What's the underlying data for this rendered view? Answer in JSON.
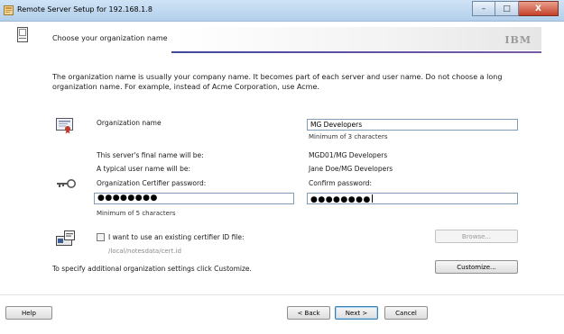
{
  "window": {
    "title": "Remote Server Setup for 192.168.1.8",
    "minimize_glyph": "–",
    "maximize_glyph": "□",
    "close_glyph": "X"
  },
  "header": {
    "heading": "Choose your organization name",
    "logo_text": "IBM"
  },
  "description": "The organization name is usually your company name. It becomes part of each server and user name. Do not choose a long organization name. For example, instead of Acme Corporation, use Acme.",
  "org": {
    "label": "Organization name",
    "value": "MG Developers",
    "hint": "Minimum of 3 characters"
  },
  "names": {
    "server_label": "This server's final name will be:",
    "server_value": "MGD01/MG Developers",
    "user_label": "A typical user name will be:",
    "user_value": "Jane Doe/MG Developers"
  },
  "password": {
    "label": "Organization Certifier password:",
    "value": "●●●●●●●●",
    "hint": "Minimum of 5 characters",
    "confirm_label": "Confirm password:",
    "confirm_value": "●●●●●●●●"
  },
  "certifier": {
    "checkbox_label": "I want to use an existing certifier ID file:",
    "checked": false,
    "path": "/local/notesdata/cert.id",
    "browse_label": "Browse..."
  },
  "customize": {
    "text": "To specify additional organization settings click Customize.",
    "button_label": "Customize..."
  },
  "footer": {
    "help_label": "Help",
    "back_label": "< Back",
    "next_label": "Next >",
    "cancel_label": "Cancel"
  },
  "icons": {
    "app": "server-setup-icon",
    "document": "document-icon",
    "org": "certificate-icon",
    "key": "key-icon",
    "cert_file": "id-file-icon"
  }
}
